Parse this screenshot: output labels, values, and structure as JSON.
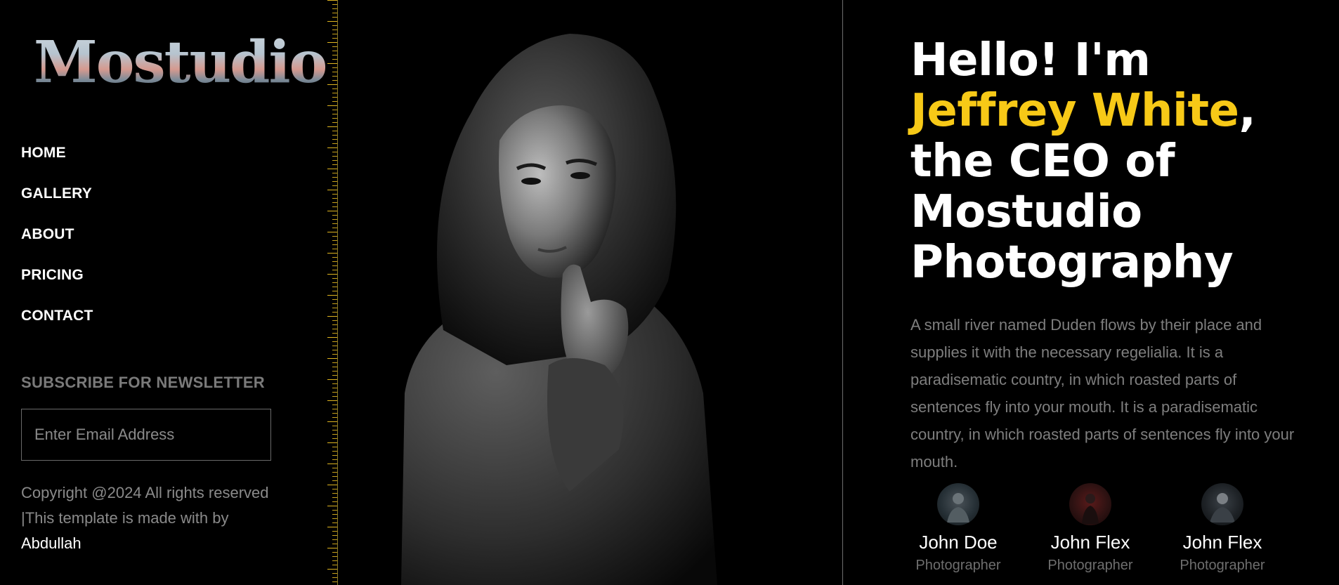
{
  "brand": {
    "logo_text": "Mostudio"
  },
  "nav": {
    "items": [
      {
        "label": "HOME"
      },
      {
        "label": "GALLERY"
      },
      {
        "label": "ABOUT"
      },
      {
        "label": "PRICING"
      },
      {
        "label": "CONTACT"
      }
    ]
  },
  "newsletter": {
    "title": "SUBSCRIBE FOR NEWSLETTER",
    "email_placeholder": "Enter Email Address",
    "email_value": ""
  },
  "footer": {
    "copyright_text": "Copyright @2024 All rights reserved |This template is made with by ",
    "author": "Abdullah"
  },
  "hero": {
    "greeting": "Hello! I'm ",
    "name": "Jeffrey White",
    "comma": ",",
    "title_rest": "the CEO of Mostudio Photography",
    "bio": "A small river named Duden flows by their place and supplies it with the necessary regelialia. It is a paradisematic country, in which roasted parts of sentences fly into your mouth. It is a paradisematic country, in which roasted parts of sentences fly into your mouth."
  },
  "team": [
    {
      "name": "John Doe",
      "role": "Photographer"
    },
    {
      "name": "John Flex",
      "role": "Photographer"
    },
    {
      "name": "John Flex",
      "role": "Photographer"
    }
  ],
  "colors": {
    "accent": "#f7c917",
    "background": "#000000",
    "muted_text": "#7e7e7e"
  }
}
